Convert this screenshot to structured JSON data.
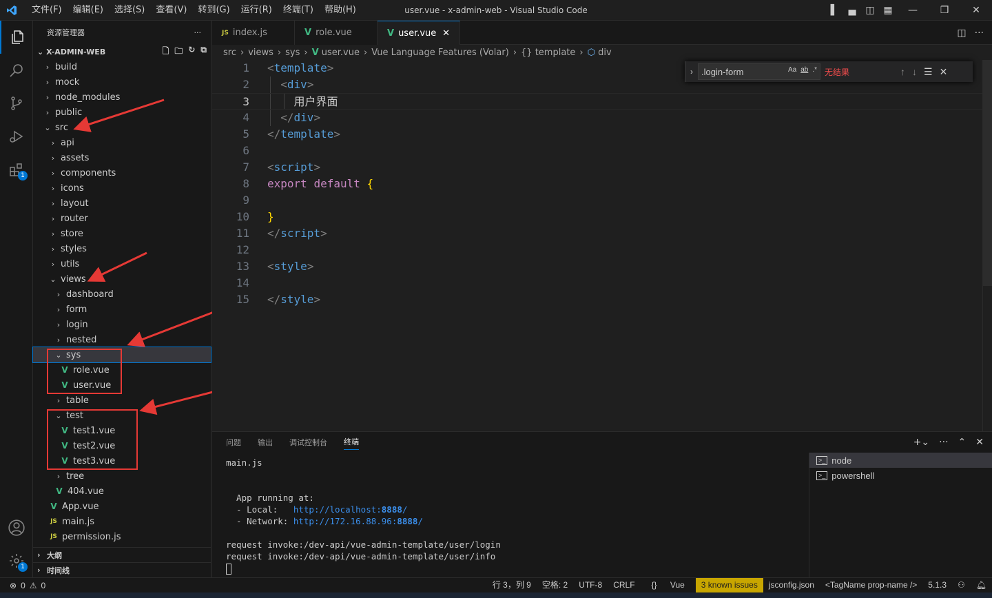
{
  "titlebar": {
    "menus": [
      "文件(F)",
      "编辑(E)",
      "选择(S)",
      "查看(V)",
      "转到(G)",
      "运行(R)",
      "终端(T)",
      "帮助(H)"
    ],
    "title": "user.vue - x-admin-web - Visual Studio Code"
  },
  "activity": {
    "extensions_badge": "1",
    "manage_badge": "1"
  },
  "sidebar": {
    "title": "资源管理器",
    "more": "···",
    "project": "X-ADMIN-WEB",
    "tree": [
      {
        "label": "build",
        "indent": 0,
        "kind": "folder",
        "open": false
      },
      {
        "label": "mock",
        "indent": 0,
        "kind": "folder",
        "open": false
      },
      {
        "label": "node_modules",
        "indent": 0,
        "kind": "folder",
        "open": false
      },
      {
        "label": "public",
        "indent": 0,
        "kind": "folder",
        "open": false
      },
      {
        "label": "src",
        "indent": 0,
        "kind": "folder",
        "open": true
      },
      {
        "label": "api",
        "indent": 1,
        "kind": "folder",
        "open": false
      },
      {
        "label": "assets",
        "indent": 1,
        "kind": "folder",
        "open": false
      },
      {
        "label": "components",
        "indent": 1,
        "kind": "folder",
        "open": false
      },
      {
        "label": "icons",
        "indent": 1,
        "kind": "folder",
        "open": false
      },
      {
        "label": "layout",
        "indent": 1,
        "kind": "folder",
        "open": false
      },
      {
        "label": "router",
        "indent": 1,
        "kind": "folder",
        "open": false
      },
      {
        "label": "store",
        "indent": 1,
        "kind": "folder",
        "open": false
      },
      {
        "label": "styles",
        "indent": 1,
        "kind": "folder",
        "open": false
      },
      {
        "label": "utils",
        "indent": 1,
        "kind": "folder",
        "open": false
      },
      {
        "label": "views",
        "indent": 1,
        "kind": "folder",
        "open": true
      },
      {
        "label": "dashboard",
        "indent": 2,
        "kind": "folder",
        "open": false
      },
      {
        "label": "form",
        "indent": 2,
        "kind": "folder",
        "open": false
      },
      {
        "label": "login",
        "indent": 2,
        "kind": "folder",
        "open": false
      },
      {
        "label": "nested",
        "indent": 2,
        "kind": "folder",
        "open": false
      },
      {
        "label": "sys",
        "indent": 2,
        "kind": "folder",
        "open": true,
        "selected": true
      },
      {
        "label": "role.vue",
        "indent": 3,
        "kind": "vue"
      },
      {
        "label": "user.vue",
        "indent": 3,
        "kind": "vue"
      },
      {
        "label": "table",
        "indent": 2,
        "kind": "folder",
        "open": false
      },
      {
        "label": "test",
        "indent": 2,
        "kind": "folder",
        "open": true
      },
      {
        "label": "test1.vue",
        "indent": 3,
        "kind": "vue"
      },
      {
        "label": "test2.vue",
        "indent": 3,
        "kind": "vue"
      },
      {
        "label": "test3.vue",
        "indent": 3,
        "kind": "vue"
      },
      {
        "label": "tree",
        "indent": 2,
        "kind": "folder",
        "open": false
      },
      {
        "label": "404.vue",
        "indent": 2,
        "kind": "vue"
      },
      {
        "label": "App.vue",
        "indent": 1,
        "kind": "vue"
      },
      {
        "label": "main.js",
        "indent": 1,
        "kind": "js"
      },
      {
        "label": "permission.js",
        "indent": 1,
        "kind": "js"
      }
    ],
    "outline": "大纲",
    "timeline": "时间线"
  },
  "tabs": [
    {
      "label": "index.js",
      "icon": "JS",
      "active": false
    },
    {
      "label": "role.vue",
      "icon": "V",
      "active": false
    },
    {
      "label": "user.vue",
      "icon": "V",
      "active": true
    }
  ],
  "breadcrumbs": [
    "src",
    "views",
    "sys",
    "user.vue",
    "Vue Language Features (Volar)",
    "template",
    "div"
  ],
  "find": {
    "value": ".login-form",
    "opt_case": "Aa",
    "opt_word": "ab",
    "opt_regex": ".*",
    "result": "无结果"
  },
  "code": [
    {
      "n": "1",
      "html": "<span class='t-br'>&lt;</span><span class='t-tag'>template</span><span class='t-br'>&gt;</span>"
    },
    {
      "n": "2",
      "html": "  <span class='t-br'>&lt;</span><span class='t-tag'>div</span><span class='t-br'>&gt;</span>"
    },
    {
      "n": "3",
      "html": "    <span class='t-txt'>用户界面</span>"
    },
    {
      "n": "4",
      "html": "  <span class='t-br'>&lt;/</span><span class='t-tag'>div</span><span class='t-br'>&gt;</span>"
    },
    {
      "n": "5",
      "html": "<span class='t-br'>&lt;/</span><span class='t-tag'>template</span><span class='t-br'>&gt;</span>"
    },
    {
      "n": "6",
      "html": ""
    },
    {
      "n": "7",
      "html": "<span class='t-br'>&lt;</span><span class='t-tag'>script</span><span class='t-br'>&gt;</span>"
    },
    {
      "n": "8",
      "html": "<span class='t-kw'>export</span> <span class='t-kw'>default</span> <span class='t-brace'>{</span>"
    },
    {
      "n": "9",
      "html": ""
    },
    {
      "n": "10",
      "html": "<span class='t-brace'>}</span>"
    },
    {
      "n": "11",
      "html": "<span class='t-br'>&lt;/</span><span class='t-tag'>script</span><span class='t-br'>&gt;</span>"
    },
    {
      "n": "12",
      "html": ""
    },
    {
      "n": "13",
      "html": "<span class='t-br'>&lt;</span><span class='t-tag'>style</span><span class='t-br'>&gt;</span>"
    },
    {
      "n": "14",
      "html": ""
    },
    {
      "n": "15",
      "html": "<span class='t-br'>&lt;/</span><span class='t-tag'>style</span><span class='t-br'>&gt;</span>"
    }
  ],
  "panel": {
    "tabs": [
      "问题",
      "输出",
      "调试控制台",
      "终端"
    ],
    "active_tab": "终端",
    "terminal_lines": [
      "main.js",
      "",
      "",
      "  App running at:",
      "  - Local:   |http://localhost:|8888|/",
      "  - Network: |http://172.16.88.96:|8888|/",
      "",
      "request invoke:/dev-api/vue-admin-template/user/login",
      "request invoke:/dev-api/vue-admin-template/user/info"
    ],
    "terminals": [
      "node",
      "powershell"
    ]
  },
  "status": {
    "errors": "0",
    "warnings": "0",
    "position": "行 3，列 9",
    "spaces": "空格: 2",
    "encoding": "UTF-8",
    "eol": "CRLF",
    "language": "Vue",
    "issues": "3 known issues",
    "config": "jsconfig.json",
    "tagname": "<TagName prop-name />",
    "version": "5.1.3"
  },
  "colors": {
    "accent": "#0078d4",
    "vue": "#41b883",
    "annotation": "#e53935",
    "warn": "#c8a600"
  }
}
